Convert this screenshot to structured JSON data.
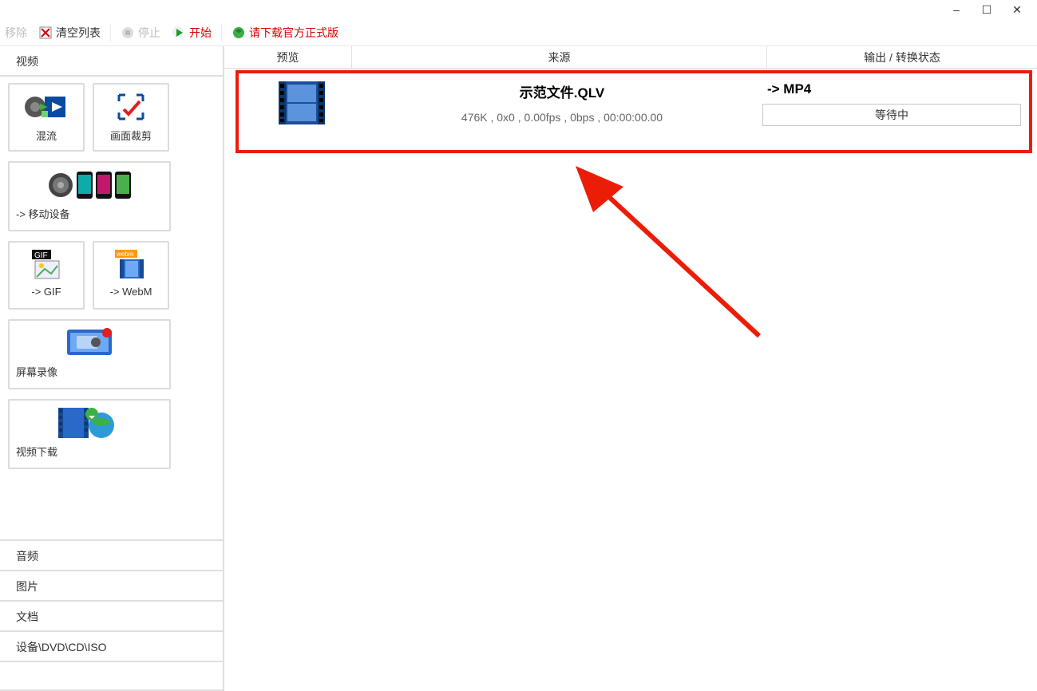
{
  "window_controls": {
    "minimize": "–",
    "maximize": "☐",
    "close": "✕"
  },
  "toolbar": {
    "remove": "移除",
    "clear_list": "清空列表",
    "stop": "停止",
    "start": "开始",
    "download_official": "请下载官方正式版"
  },
  "sidebar": {
    "active_section": "视频",
    "tiles": {
      "mix": "混流",
      "crop": "画面裁剪",
      "mobile": "-> 移动设备",
      "gif": "-> GIF",
      "webm": "-> WebM",
      "screen_record": "屏幕录像",
      "video_download": "视频下载"
    },
    "categories": [
      "音频",
      "图片",
      "文档",
      "设备\\DVD\\CD\\ISO"
    ]
  },
  "columns": {
    "preview": "预览",
    "source": "来源",
    "output": "输出 / 转换状态"
  },
  "item": {
    "filename": "示范文件.QLV",
    "meta": "476K , 0x0 , 0.00fps , 0bps , 00:00:00.00",
    "output_format": "->  MP4",
    "status": "等待中"
  }
}
